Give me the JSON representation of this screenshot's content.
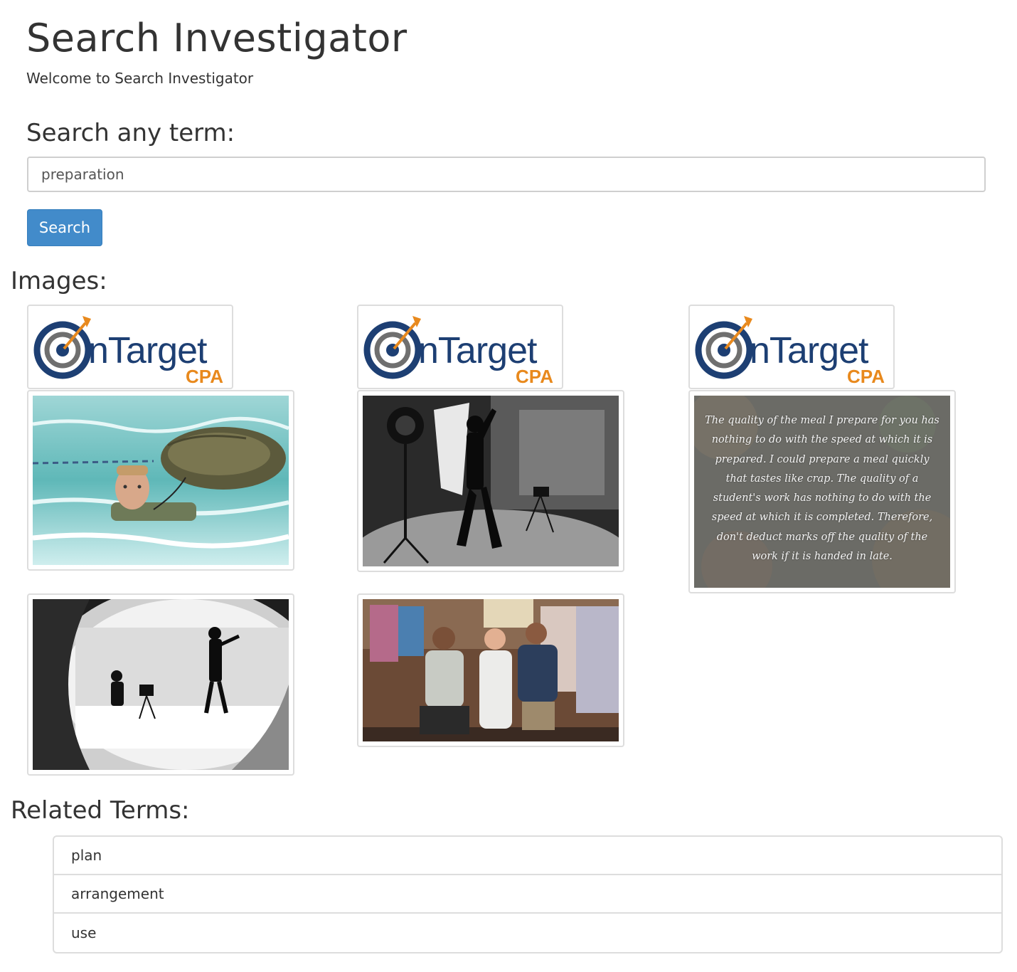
{
  "page": {
    "title": "Search Investigator",
    "welcome": "Welcome to Search Investigator"
  },
  "search": {
    "label": "Search any term:",
    "value": "preparation",
    "button_label": "Search"
  },
  "images": {
    "heading": "Images:",
    "logo": {
      "word": "nTarget",
      "sub": "CPA",
      "brand_navy": "#1d3f73",
      "brand_orange": "#e8891d"
    },
    "quote_text": "The quality of the meal I prepare for you has nothing to do with the speed at which it is prepared. I could prepare a meal quickly that tastes like crap. The quality of a student's work has nothing to do with the speed at which it is completed. Therefore, don't deduct marks off the quality of the work if it is handed in late."
  },
  "related": {
    "heading": "Related Terms:",
    "terms": [
      "plan",
      "arrangement",
      "use"
    ]
  },
  "colors": {
    "primary_button": "#428bca",
    "border": "#dddddd",
    "text": "#333333"
  }
}
